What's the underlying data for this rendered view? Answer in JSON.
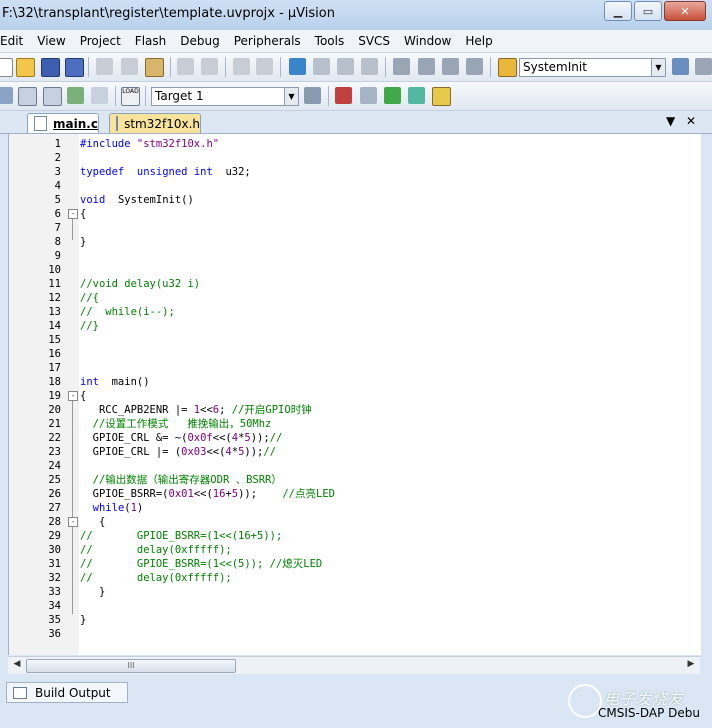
{
  "window": {
    "title": "F:\\32\\transplant\\register\\template.uvprojx - µVision"
  },
  "menubar": [
    "Edit",
    "View",
    "Project",
    "Flash",
    "Debug",
    "Peripherals",
    "Tools",
    "SVCS",
    "Window",
    "Help"
  ],
  "toolbar": {
    "function_combo": "SystemInit",
    "target_combo": "Target 1"
  },
  "tabs": [
    {
      "label": "main.c",
      "active": true
    },
    {
      "label": "stm32f10x.h",
      "active": false
    }
  ],
  "editor": {
    "lines": [
      {
        "n": "1",
        "code": "#include \"stm32f10x.h\""
      },
      {
        "n": "2",
        "code": ""
      },
      {
        "n": "3",
        "code": "typedef  unsigned int  u32;"
      },
      {
        "n": "4",
        "code": ""
      },
      {
        "n": "5",
        "code": "void  SystemInit()"
      },
      {
        "n": "6",
        "code": "{",
        "fold": "-"
      },
      {
        "n": "7",
        "code": ""
      },
      {
        "n": "8",
        "code": "}"
      },
      {
        "n": "9",
        "code": ""
      },
      {
        "n": "10",
        "code": ""
      },
      {
        "n": "11",
        "code": "//void delay(u32 i)"
      },
      {
        "n": "12",
        "code": "//{"
      },
      {
        "n": "13",
        "code": "//  while(i--);"
      },
      {
        "n": "14",
        "code": "//}"
      },
      {
        "n": "15",
        "code": ""
      },
      {
        "n": "16",
        "code": ""
      },
      {
        "n": "17",
        "code": ""
      },
      {
        "n": "18",
        "code": "int  main()"
      },
      {
        "n": "19",
        "code": "{",
        "fold": "-"
      },
      {
        "n": "20",
        "code": "   RCC_APB2ENR |= 1<<6; //开启GPIO时钟"
      },
      {
        "n": "21",
        "code": "  //设置工作模式   推挽输出，50Mhz"
      },
      {
        "n": "22",
        "code": "  GPIOE_CRL &= ~(0x0f<<(4*5));//"
      },
      {
        "n": "23",
        "code": "  GPIOE_CRL |= (0x03<<(4*5));//"
      },
      {
        "n": "24",
        "code": ""
      },
      {
        "n": "25",
        "code": "  //输出数据（输出寄存器ODR 、BSRR）"
      },
      {
        "n": "26",
        "code": "  GPIOE_BSRR=(0x01<<(16+5));    //点亮LED"
      },
      {
        "n": "27",
        "code": "  while(1)"
      },
      {
        "n": "28",
        "code": "   {",
        "fold": "-"
      },
      {
        "n": "29",
        "code": "//       GPIOE_BSRR=(1<<(16+5));"
      },
      {
        "n": "30",
        "code": "//       delay(0xfffff);"
      },
      {
        "n": "31",
        "code": "//       GPIOE_BSRR=(1<<(5)); //熄灭LED"
      },
      {
        "n": "32",
        "code": "//       delay(0xfffff);"
      },
      {
        "n": "33",
        "code": "   }"
      },
      {
        "n": "34",
        "code": ""
      },
      {
        "n": "35",
        "code": "}"
      },
      {
        "n": "36",
        "code": ""
      }
    ]
  },
  "scrollbar": {
    "thumb_label": "III"
  },
  "bottom": {
    "build_output_tab": "Build Output",
    "status_text": "CMSIS-DAP Debu"
  },
  "watermark": {
    "text": "电子发烧友"
  },
  "colors": {
    "keyword": "#0000ff",
    "comment": "#008000",
    "string": "#800080"
  }
}
